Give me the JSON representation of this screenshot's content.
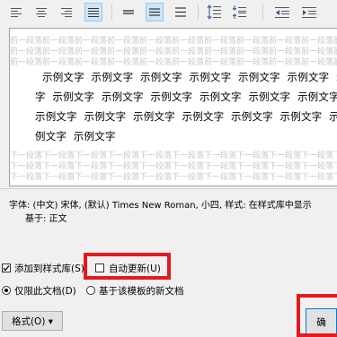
{
  "toolbar": {
    "buttons": [
      {
        "name": "align-left-button",
        "active": false
      },
      {
        "name": "align-center-button",
        "active": false
      },
      {
        "name": "align-right-button",
        "active": false
      },
      {
        "name": "align-justify-button",
        "active": true
      },
      {
        "name": "line-spacing-single-button",
        "active": false
      },
      {
        "name": "line-spacing-1-5-button",
        "active": true
      },
      {
        "name": "line-spacing-double-button",
        "active": false
      },
      {
        "name": "space-before-increase-button",
        "active": false
      },
      {
        "name": "space-before-decrease-button",
        "active": false
      },
      {
        "name": "indent-decrease-button",
        "active": false
      },
      {
        "name": "indent-increase-button",
        "active": false
      }
    ]
  },
  "preview": {
    "ghost_text": "前一段落前一段落前一段落前一段落前一段落前一段落前一段落前一段落前一段落前一段落前一段落",
    "ghost_text_after": "下一段落下一段落下一段落下一段落下一段落下一段落下一段落下一段落下一段落下一段落下一段落",
    "sample_lines": [
      "示例文字  示例文字  示例文字  示例文字  示例文字  示例文字  示例文字",
      "字  示例文字  示例文字  示例文字  示例文字  示例文字  示例文字  示例文",
      "示例文字  示例文字  示例文字  示例文字  示例文字  示例文字  示例文字",
      "例文字  示例文字"
    ]
  },
  "description": {
    "line1": "字体: (中文) 宋体, (默认) Times New Roman, 小四, 样式: 在样式库中显示",
    "line2": "基于: 正文"
  },
  "options": {
    "add_to_gallery_label": "添加到样式库(S)",
    "add_to_gallery_checked": true,
    "auto_update_label": "自动更新(U)",
    "auto_update_checked": false,
    "only_this_doc_label": "仅限此文档(D)",
    "new_docs_label": "基于该模板的新文档"
  },
  "buttons": {
    "format_label": "格式(O) ▾",
    "ok_label": "确"
  },
  "colors": {
    "highlight": "#e5191f",
    "active_button": "#cce4f7"
  }
}
